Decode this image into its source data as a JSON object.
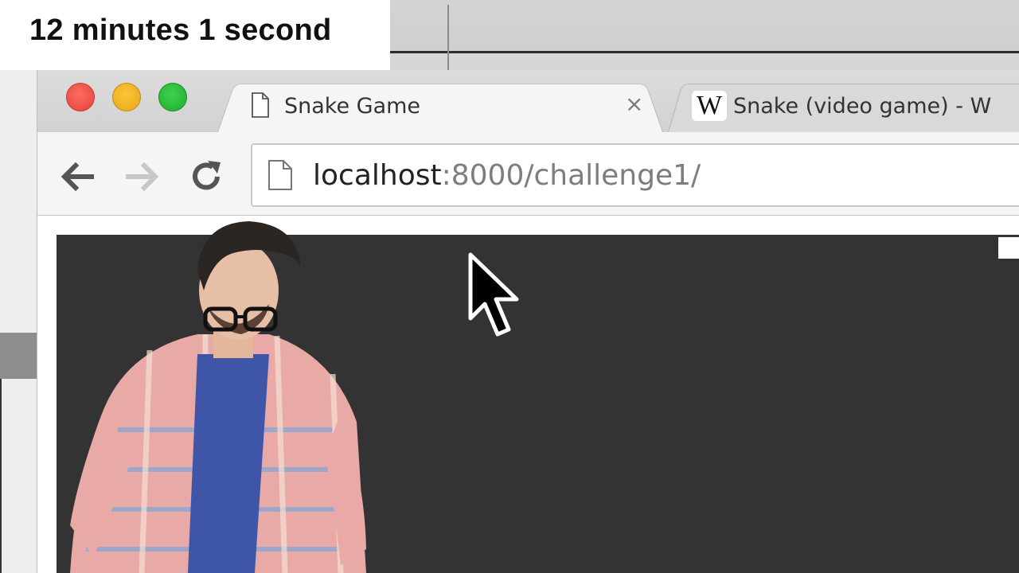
{
  "timer": {
    "text": "12 minutes 1 second"
  },
  "window": {
    "traffic_lights": [
      "close",
      "minimize",
      "zoom"
    ],
    "colors": {
      "close": "#e0443a",
      "minimize": "#e3a51a",
      "zoom": "#21a92e"
    }
  },
  "tabs": [
    {
      "title": "Snake Game",
      "icon": "page-icon",
      "active": true,
      "close_label": "×"
    },
    {
      "title": "Snake (video game) - W",
      "icon": "wikipedia-icon",
      "icon_text": "W",
      "active": false
    }
  ],
  "toolbar": {
    "back_icon": "back-arrow-icon",
    "forward_icon": "forward-arrow-icon",
    "reload_icon": "reload-icon",
    "url_host": "localhost",
    "url_path": ":8000/challenge1/"
  },
  "game": {
    "background_color": "#333333",
    "food_color": "#ffffff"
  },
  "presenter": {
    "description": "person in plaid shirt"
  }
}
